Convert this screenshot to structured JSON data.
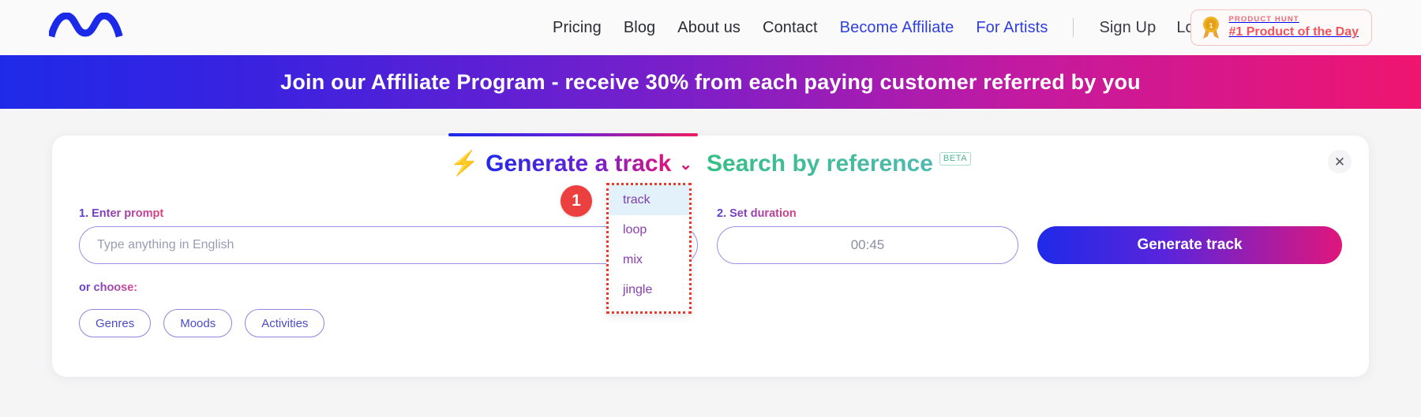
{
  "header": {
    "logo_icon": "wave-logo-icon",
    "nav": [
      {
        "label": "Pricing",
        "accent": false
      },
      {
        "label": "Blog",
        "accent": false
      },
      {
        "label": "About us",
        "accent": false
      },
      {
        "label": "Contact",
        "accent": false
      },
      {
        "label": "Become Affiliate",
        "accent": true
      },
      {
        "label": "For Artists",
        "accent": true
      }
    ],
    "auth": [
      {
        "label": "Sign Up"
      },
      {
        "label": "Log In"
      }
    ],
    "product_hunt": {
      "icon": "medal-icon",
      "kicker": "PRODUCT HUNT",
      "title": "#1 Product of the Day"
    }
  },
  "banner": {
    "text": "Join our Affiliate Program - receive 30% from each paying customer referred by you",
    "gradient_start": "#1f2ae8",
    "gradient_end": "#ef1570"
  },
  "card": {
    "tabs": {
      "generate": {
        "bolt_icon": "lightning-bolt-icon",
        "label": "Generate a track",
        "chevron_icon": "chevron-down-icon",
        "active": true
      },
      "search": {
        "label": "Search by reference",
        "badge": "BETA",
        "active": false
      }
    },
    "close_icon": "close-icon",
    "form": {
      "prompt": {
        "label": "1. Enter prompt",
        "value": "",
        "placeholder": "Type anything in English"
      },
      "duration": {
        "label": "2. Set duration",
        "value": "00:45"
      },
      "generate_button": "Generate track",
      "or_choose": "or choose:",
      "chips": [
        {
          "label": "Genres"
        },
        {
          "label": "Moods"
        },
        {
          "label": "Activities"
        }
      ]
    }
  },
  "annotation": {
    "step_number": "1",
    "highlight_color": "#e8392f",
    "badge_color": "#ec4040"
  },
  "dropdown": {
    "options": [
      {
        "label": "track",
        "selected": true
      },
      {
        "label": "loop",
        "selected": false
      },
      {
        "label": "mix",
        "selected": false
      },
      {
        "label": "jingle",
        "selected": false
      }
    ]
  }
}
